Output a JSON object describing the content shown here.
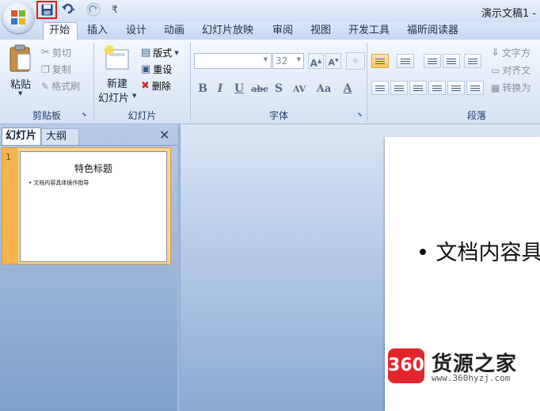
{
  "window": {
    "title": "演示文稿1 -"
  },
  "ribbon_tabs": [
    "开始",
    "插入",
    "设计",
    "动画",
    "幻灯片放映",
    "审阅",
    "视图",
    "开发工具",
    "福昕阅读器"
  ],
  "clipboard": {
    "paste": "粘贴",
    "cut": "剪切",
    "copy": "复制",
    "format_painter": "格式刷",
    "group": "剪贴板"
  },
  "slides_group": {
    "new_slide_1": "新建",
    "new_slide_2": "幻灯片",
    "layout": "版式",
    "reset": "重设",
    "delete": "删除",
    "group": "幻灯片"
  },
  "font_group": {
    "font_size": "32",
    "group": "字体",
    "bold": "B",
    "italic": "I",
    "underline": "U",
    "strike": "abc",
    "shadow": "S",
    "spacing": "AV",
    "case": "Aa",
    "color": "A"
  },
  "paragraph_group": {
    "text_direction": "文字方",
    "align_text": "对齐文",
    "convert": "转换为",
    "group": "段落"
  },
  "pane": {
    "tab_slides": "幻灯片",
    "tab_outline": "大纲",
    "close": "✕"
  },
  "thumbnail": {
    "number": "1",
    "title": "特色标题",
    "bullet": "•  文档内容具体操作指导"
  },
  "slide": {
    "bullet": "•  文档内容具"
  },
  "watermark": {
    "logo": "360",
    "name": "货源之家",
    "url": "www.360hyzj.com"
  },
  "colors": {
    "accent": "#e11c1c",
    "ribbon_text": "#1e3c6c",
    "watermark_red": "#e3262d"
  }
}
